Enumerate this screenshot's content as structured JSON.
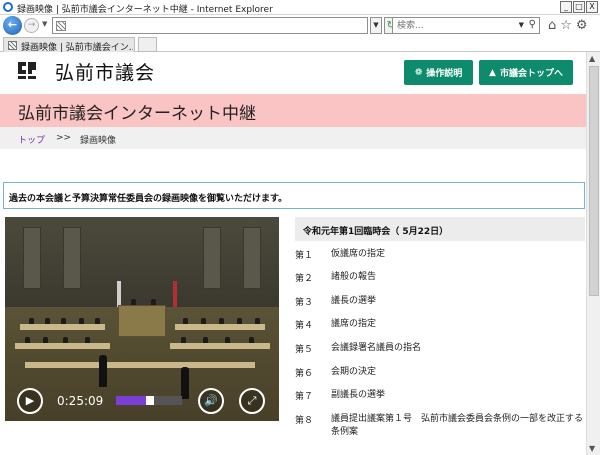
{
  "browser": {
    "window_title": "録画映像 | 弘前市議会インターネット中継 - Internet Explorer",
    "address_url": "",
    "search_placeholder": "検索...",
    "tab_label": "録画映像 | 弘前市議会イン...",
    "window_buttons": [
      "_",
      "□",
      "X"
    ]
  },
  "site": {
    "title": "弘前市議会",
    "buttons": {
      "help": "操作説明",
      "top": "市議会トップへ"
    },
    "heading": "弘前市議会インターネット中継",
    "breadcrumb": {
      "home": "トップ",
      "separator": ">>",
      "current": "録画映像"
    },
    "notice": "過去の本会議と予算決算常任委員会の録画映像を御覧いただけます。",
    "colors": {
      "accent_green": "#0e8a6d",
      "banner_pink": "#fbc4c4",
      "link_purple": "#7a2ea0",
      "progress_purple": "#7b3fd8"
    }
  },
  "player": {
    "time": "0:25:09",
    "volume_level": 0.45,
    "icons": [
      "play-icon",
      "volume-icon",
      "fullscreen-icon"
    ]
  },
  "session": {
    "title": "令和元年第1回臨時会（ 5月22日）",
    "items": [
      {
        "no": "第１",
        "text": "仮議席の指定"
      },
      {
        "no": "第２",
        "text": "諸般の報告"
      },
      {
        "no": "第３",
        "text": "議長の選挙"
      },
      {
        "no": "第４",
        "text": "議席の指定"
      },
      {
        "no": "第５",
        "text": "会議録署名議員の指名"
      },
      {
        "no": "第６",
        "text": "会期の決定"
      },
      {
        "no": "第７",
        "text": "副議長の選挙"
      },
      {
        "no": "第８",
        "text": "議員提出議案第１号　弘前市議会委員会条例の一部を改正する条例案"
      }
    ]
  }
}
